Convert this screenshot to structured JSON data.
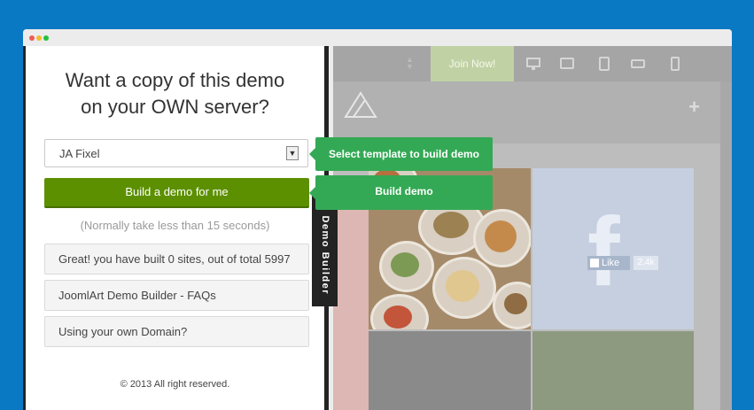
{
  "panel": {
    "headline_line1": "Want a copy of this demo",
    "headline_line2": "on your OWN server?",
    "template_select": {
      "value": "JA Fixel"
    },
    "build_button": "Build a demo for me",
    "note": "(Normally take less than 15 seconds)",
    "links": [
      "Great! you have built 0 sites, out of total 5997",
      "JoomlArt Demo Builder - FAQs",
      "Using your own Domain?"
    ],
    "footer": "© 2013 All right reserved."
  },
  "demo_tab": {
    "label": "+ Demo Builder"
  },
  "callouts": {
    "select": "Select template to build demo",
    "build": "Build demo"
  },
  "site": {
    "join_button": "Join Now!",
    "header_plus": "+",
    "facebook": {
      "letter": "f",
      "like_label": "Like",
      "like_count": "2.4k"
    },
    "device_icons": [
      "desktop-icon",
      "laptop-icon",
      "tablet-icon",
      "tablet-landscape-icon",
      "phone-icon"
    ]
  },
  "colors": {
    "background": "#0a79c3",
    "build_button": "#5c9000",
    "callout": "#34a955",
    "panel_border": "#232323"
  }
}
